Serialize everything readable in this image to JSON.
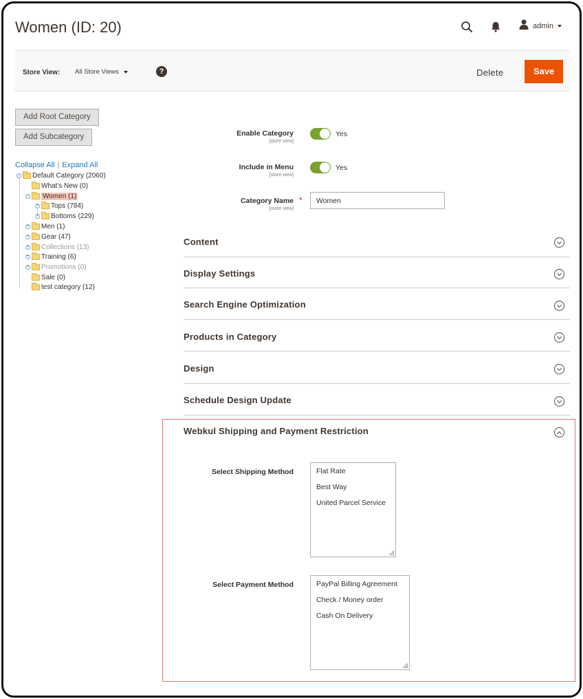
{
  "header": {
    "title": "Women (ID: 20)",
    "user": "admin",
    "icons": [
      "search-icon",
      "bell-icon",
      "user-icon"
    ]
  },
  "toolbar": {
    "store_view_label": "Store View:",
    "store_view_value": "All Store Views",
    "help_label": "?",
    "delete_label": "Delete",
    "save_label": "Save",
    "save_color": "#eb5202"
  },
  "sidebar": {
    "add_root_label": "Add Root Category",
    "add_sub_label": "Add Subcategory",
    "collapse_all": "Collapse All",
    "separator": "|",
    "expand_all": "Expand All",
    "tree": [
      {
        "label": "Default Category (2060)"
      },
      {
        "label": "What's New (0)"
      },
      {
        "label": "Women (1)",
        "selected": true
      },
      {
        "label": "Tops (784)"
      },
      {
        "label": "Bottoms (229)"
      },
      {
        "label": "Men (1)"
      },
      {
        "label": "Gear (47)"
      },
      {
        "label": "Collections (13)",
        "muted": true
      },
      {
        "label": "Training (6)"
      },
      {
        "label": "Promotions (0)",
        "muted": true
      },
      {
        "label": "Sale (0)"
      },
      {
        "label": "test category (12)"
      }
    ]
  },
  "form": {
    "enable_category": {
      "label": "Enable Category",
      "scope": "[store view]",
      "value": "Yes"
    },
    "include_in_menu": {
      "label": "Include in Menu",
      "scope": "[store view]",
      "value": "Yes"
    },
    "category_name": {
      "label": "Category Name",
      "required_mark": "*",
      "scope": "[store view]",
      "value": "Women"
    },
    "toggle_color": "#79a22e"
  },
  "sections": [
    {
      "title": "Content"
    },
    {
      "title": "Display Settings"
    },
    {
      "title": "Search Engine Optimization"
    },
    {
      "title": "Products in Category"
    },
    {
      "title": "Design"
    },
    {
      "title": "Schedule Design Update"
    },
    {
      "title": "Webkul Shipping and Payment Restriction",
      "expanded": true
    }
  ],
  "restriction": {
    "shipping_label": "Select Shipping Method",
    "shipping_options": [
      "Flat Rate",
      "Best Way",
      "United Parcel Service"
    ],
    "payment_label": "Select Payment Method",
    "payment_options": [
      "PayPal Billing Agreement",
      "Check / Money order",
      "Cash On Delivery"
    ]
  }
}
